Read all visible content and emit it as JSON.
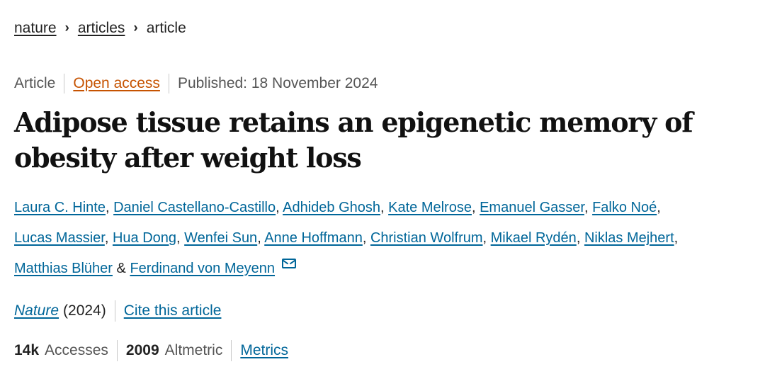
{
  "breadcrumb": {
    "items": [
      "nature",
      "articles"
    ],
    "current": "article",
    "separator": "›"
  },
  "meta": {
    "type": "Article",
    "access": "Open access",
    "published": "Published: 18 November 2024"
  },
  "title": "Adipose tissue retains an epigenetic memory of obesity after weight loss",
  "authors": {
    "line1": [
      "Laura C. Hinte",
      "Daniel Castellano-Castillo",
      "Adhideb Ghosh",
      "Kate Melrose",
      "Emanuel Gasser",
      "Falko Noé"
    ],
    "line2": [
      "Lucas Massier",
      "Hua Dong",
      "Wenfei Sun",
      "Anne Hoffmann",
      "Christian Wolfrum",
      "Mikael Rydén",
      "Niklas Mejhert"
    ],
    "line3a": "Matthias Blüher",
    "amp": "&",
    "line3b": "Ferdinand von Meyenn",
    "punct": ","
  },
  "citation": {
    "journal": "Nature",
    "year": "(2024)",
    "cite_link": "Cite this article"
  },
  "metrics": {
    "accesses_value": "14k",
    "accesses_label": "Accesses",
    "altmetric_value": "2009",
    "altmetric_label": "Altmetric",
    "metrics_link": "Metrics"
  },
  "colors": {
    "link": "#006699",
    "open_access": "#c65301",
    "text": "#222222"
  },
  "icons": {
    "email": "envelope-icon"
  }
}
